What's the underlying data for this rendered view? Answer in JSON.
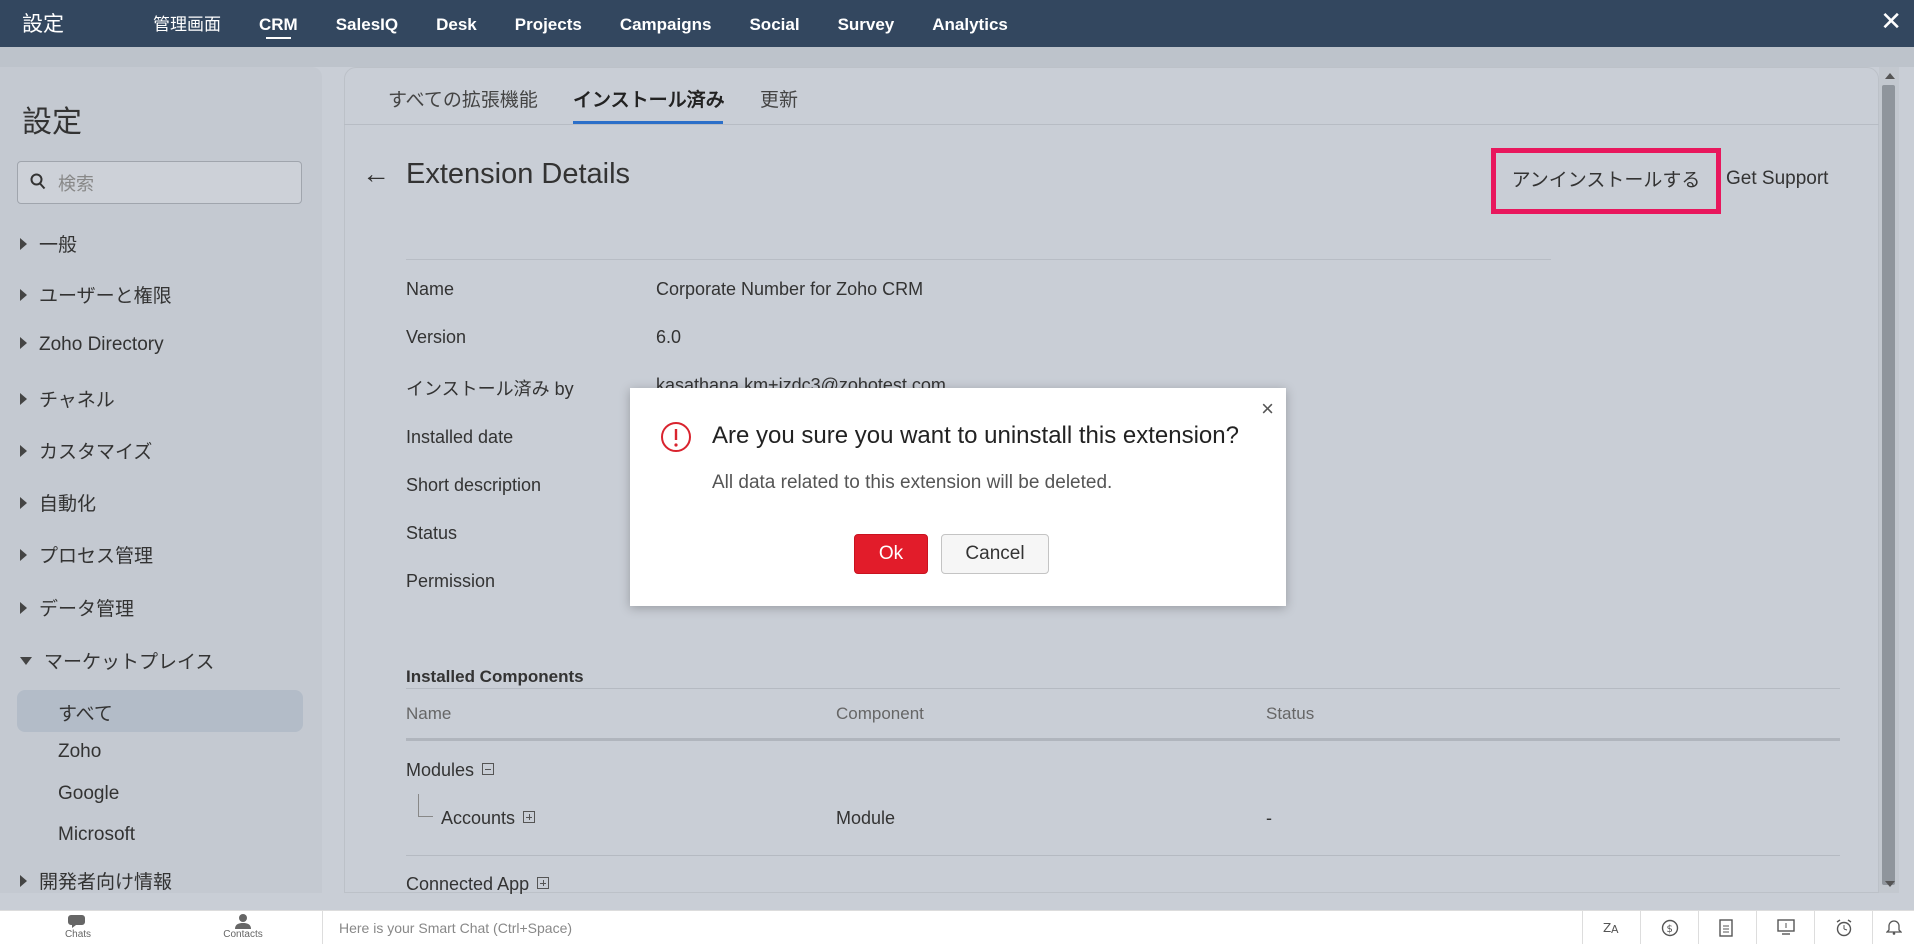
{
  "topbar": {
    "brand": "設定",
    "nav": [
      "管理画面",
      "CRM",
      "SalesIQ",
      "Desk",
      "Projects",
      "Campaigns",
      "Social",
      "Survey",
      "Analytics"
    ],
    "active_nav": "CRM",
    "close_glyph": "✕"
  },
  "sidebar": {
    "title": "設定",
    "search_placeholder": "検索",
    "items": [
      {
        "label": "一般",
        "expanded": false
      },
      {
        "label": "ユーザーと権限",
        "expanded": false
      },
      {
        "label": "Zoho Directory",
        "expanded": false
      },
      {
        "label": "チャネル",
        "expanded": false
      },
      {
        "label": "カスタマイズ",
        "expanded": false
      },
      {
        "label": "自動化",
        "expanded": false
      },
      {
        "label": "プロセス管理",
        "expanded": false
      },
      {
        "label": "データ管理",
        "expanded": false
      },
      {
        "label": "マーケットプレイス",
        "expanded": true
      }
    ],
    "sub_items": [
      "すべて",
      "Zoho",
      "Google",
      "Microsoft"
    ],
    "active_sub": "すべて",
    "last_item": "開発者向け情報"
  },
  "tabs": [
    "すべての拡張機能",
    "インストール済み",
    "更新"
  ],
  "active_tab": "インストール済み",
  "page": {
    "back_glyph": "←",
    "title": "Extension Details",
    "uninstall_label": "アンインストールする",
    "support_label": "Get Support"
  },
  "details": [
    {
      "label": "Name",
      "value": "Corporate Number for Zoho CRM"
    },
    {
      "label": "Version",
      "value": "6.0"
    },
    {
      "label": "インストール済み by",
      "value": "kasathana.km+jzdc3@zohotest.com"
    },
    {
      "label": "Installed date",
      "value": ""
    },
    {
      "label": "Short description",
      "value": ""
    },
    {
      "label": "Status",
      "value": ""
    },
    {
      "label": "Permission",
      "value": ""
    }
  ],
  "components": {
    "title": "Installed Components",
    "headers": [
      "Name",
      "Component",
      "Status"
    ],
    "group1": "Modules",
    "rows": [
      {
        "name": "Accounts",
        "component": "Module",
        "status": "-"
      }
    ],
    "group2": "Connected App"
  },
  "dialog": {
    "question": "Are you sure you want to uninstall this extension?",
    "message": "All data related to this extension will be deleted.",
    "ok": "Ok",
    "cancel": "Cancel",
    "close_glyph": "×"
  },
  "bottombar": {
    "chats": "Chats",
    "contacts": "Contacts",
    "smartchat_placeholder": "Here is your Smart Chat (Ctrl+Space)"
  },
  "colors": {
    "topbar": "#33475f",
    "highlight_border": "#e8175d",
    "ok_button": "#e21c2a",
    "tab_underline": "#2b6fc9"
  }
}
